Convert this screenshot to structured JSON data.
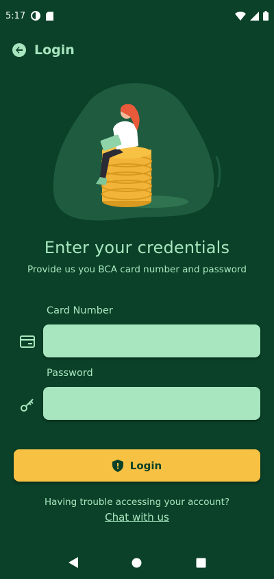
{
  "status_bar": {
    "time": "5:17",
    "icons": [
      "data-saver-icon",
      "sim-card-icon",
      "wifi-icon",
      "signal-icon",
      "battery-icon"
    ]
  },
  "app_bar": {
    "title": "Login",
    "back_icon": "arrow-back-icon"
  },
  "illustration": {
    "description_icon": "person-on-coins-illustration"
  },
  "content": {
    "headline": "Enter your credentials",
    "subhead": "Provide us you BCA card number and password"
  },
  "form": {
    "card_label": "Card Number",
    "card_value": "",
    "card_icon": "credit-card-icon",
    "password_label": "Password",
    "password_value": "",
    "password_icon": "key-icon"
  },
  "actions": {
    "login_label": "Login",
    "login_icon": "shield-icon",
    "trouble_text": "Having trouble accessing your account?",
    "chat_link": "Chat with us"
  },
  "colors": {
    "background": "#0a4128",
    "accent_light": "#a8e6bf",
    "button_yellow": "#f7c143",
    "blob": "#1e5b3f"
  }
}
